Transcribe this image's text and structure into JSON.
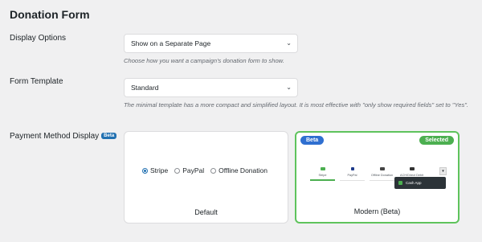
{
  "page": {
    "title": "Donation Form"
  },
  "display_options": {
    "label": "Display Options",
    "selected": "Show on a Separate Page",
    "description": "Choose how you want a campaign's donation form to show."
  },
  "form_template": {
    "label": "Form Template",
    "selected": "Standard",
    "description": "The minimal template has a more compact and simplified layout. It is most effective with \"only show required fields\" set to \"Yes\"."
  },
  "payment_method_display": {
    "label": "Payment Method Display",
    "beta_badge": "Beta",
    "options": [
      {
        "name": "Default",
        "radios": [
          {
            "label": "Stripe",
            "checked": true
          },
          {
            "label": "PayPal",
            "checked": false
          },
          {
            "label": "Offline Donation",
            "checked": false
          }
        ]
      },
      {
        "name": "Modern (Beta)",
        "beta_badge": "Beta",
        "selected_badge": "Selected",
        "selected": true,
        "methods": [
          "Stripe",
          "PayPal",
          "Offline Donation",
          "ACH/Direct Debit"
        ],
        "popover_item": "Cash App"
      }
    ]
  },
  "colors": {
    "accent": "#2271b1",
    "selected_green": "#5ec35c",
    "beta_blue": "#2f6fd0"
  }
}
